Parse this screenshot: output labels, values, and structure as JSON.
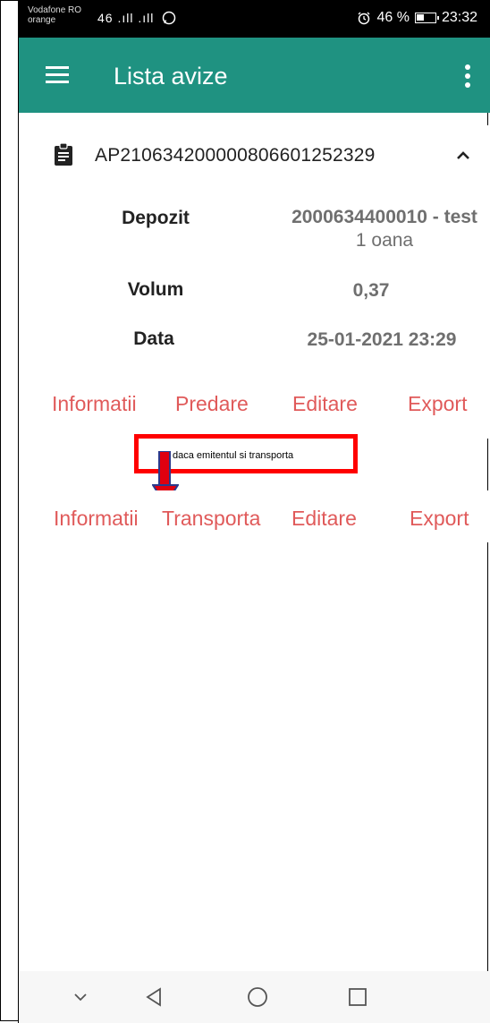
{
  "status_bar": {
    "carrier_line1": "Vodafone RO",
    "carrier_line2": "orange",
    "signal_text": "46 .ıll .ıll",
    "battery_text": "46 %",
    "time": "23:32"
  },
  "app_bar": {
    "title": "Lista avize",
    "menu_icon": "hamburger-icon",
    "overflow_icon": "more-vert-icon",
    "color": "#1f9281"
  },
  "card": {
    "aviz_number": "AP21063420000008066012523 29",
    "aviz_number_display": "AP210634200000806601252329",
    "header_icon": "clipboard-icon",
    "toggle_icon": "chevron-up-icon",
    "fields": [
      {
        "label": "Depozit",
        "value_line1": "2000634400010 - test",
        "value_line2": "1 oana"
      },
      {
        "label": "Volum",
        "value_line1": "0,37"
      },
      {
        "label": "Data",
        "value_line1": "25-01-2021 23:29"
      }
    ],
    "actions": [
      "Informatii",
      "Predare",
      "Editare",
      "Export"
    ]
  },
  "callout": {
    "text": "daca emitentul si transporta",
    "border_color": "#ff0000"
  },
  "card2": {
    "actions": [
      "Informatii",
      "Transporta",
      "Editare",
      "Export"
    ]
  },
  "nav_bar": {
    "icons": [
      "chevron-down-icon",
      "back-triangle-icon",
      "home-circle-icon",
      "recents-square-icon"
    ]
  }
}
